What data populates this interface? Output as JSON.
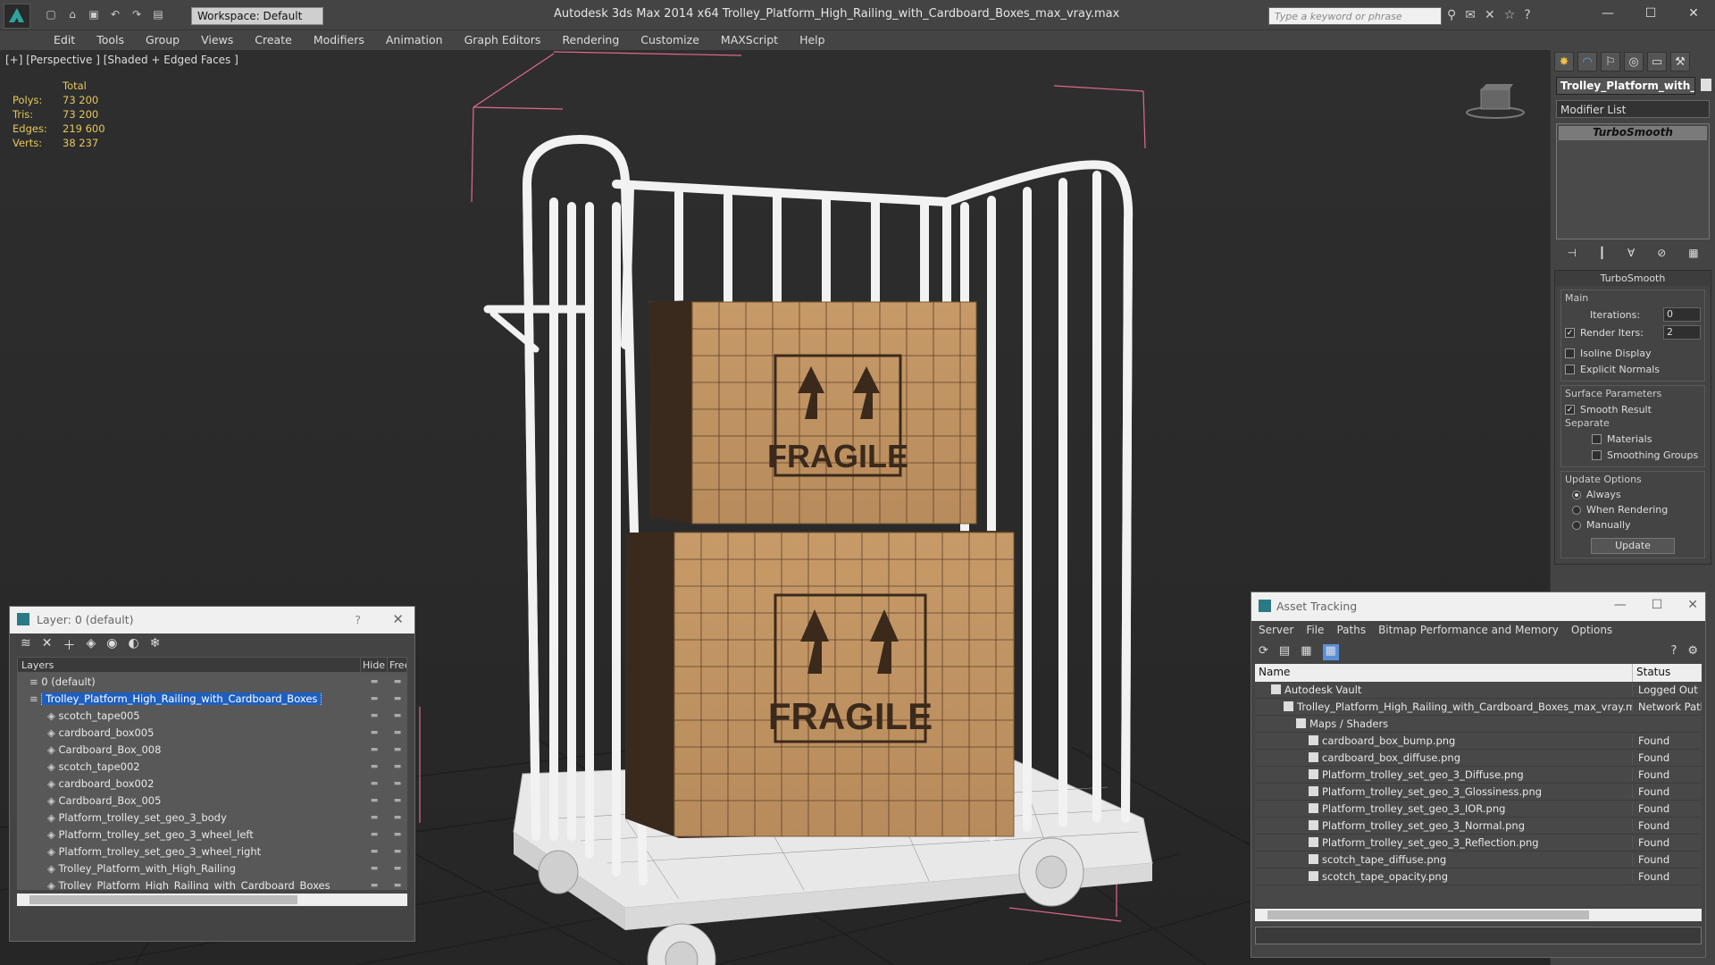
{
  "titlebar": {
    "workspace": "Workspace: Default",
    "title": "Autodesk 3ds Max  2014 x64     Trolley_Platform_High_Railing_with_Cardboard_Boxes_max_vray.max",
    "search_placeholder": "Type a keyword or phrase"
  },
  "menu": [
    "Edit",
    "Tools",
    "Group",
    "Views",
    "Create",
    "Modifiers",
    "Animation",
    "Graph Editors",
    "Rendering",
    "Customize",
    "MAXScript",
    "Help"
  ],
  "viewport": {
    "label": "[+] [Perspective ] [Shaded + Edged Faces ]",
    "stats": {
      "header": "Total",
      "rows": [
        {
          "k": "Polys:",
          "v": "73 200"
        },
        {
          "k": "Tris:",
          "v": "73 200"
        },
        {
          "k": "Edges:",
          "v": "219 600"
        },
        {
          "k": "Verts:",
          "v": "38 237"
        }
      ]
    },
    "box_label_top": "FRAGILE",
    "box_label_bottom": "FRAGILE"
  },
  "command_panel": {
    "object_name": "Trolley_Platform_with_H",
    "modifier_list": "Modifier List",
    "stack_item": "TurboSmooth",
    "rollout_title": "TurboSmooth",
    "main_label": "Main",
    "iterations_label": "Iterations:",
    "iterations_value": "0",
    "render_iters_label": "Render Iters:",
    "render_iters_value": "2",
    "isoline_label": "Isoline Display",
    "explicit_label": "Explicit Normals",
    "surface_label": "Surface Parameters",
    "smooth_result_label": "Smooth Result",
    "separate_label": "Separate",
    "materials_label": "Materials",
    "smoothing_label": "Smoothing Groups",
    "update_options_label": "Update Options",
    "radio_always": "Always",
    "radio_rendering": "When Rendering",
    "radio_manually": "Manually",
    "update_button": "Update"
  },
  "layer_window": {
    "title": "Layer: 0 (default)",
    "help": "?",
    "col_layers": "Layers",
    "col_hide": "Hide",
    "col_freeze": "Free",
    "rows": [
      {
        "label": "0 (default)",
        "indent": 0
      },
      {
        "label": "Trolley_Platform_High_Railing_with_Cardboard_Boxes",
        "indent": 0,
        "selected": true
      },
      {
        "label": "scotch_tape005",
        "indent": 1
      },
      {
        "label": "cardboard_box005",
        "indent": 1
      },
      {
        "label": "Cardboard_Box_008",
        "indent": 1
      },
      {
        "label": "scotch_tape002",
        "indent": 1
      },
      {
        "label": "cardboard_box002",
        "indent": 1
      },
      {
        "label": "Cardboard_Box_005",
        "indent": 1
      },
      {
        "label": "Platform_trolley_set_geo_3_body",
        "indent": 1
      },
      {
        "label": "Platform_trolley_set_geo_3_wheel_left",
        "indent": 1
      },
      {
        "label": "Platform_trolley_set_geo_3_wheel_right",
        "indent": 1
      },
      {
        "label": "Trolley_Platform_with_High_Railing",
        "indent": 1
      },
      {
        "label": "Trolley_Platform_High_Railing_with_Cardboard_Boxes",
        "indent": 1
      }
    ]
  },
  "asset_window": {
    "title": "Asset Tracking",
    "menu": [
      "Server",
      "File",
      "Paths",
      "Bitmap Performance and Memory",
      "Options"
    ],
    "col_name": "Name",
    "col_status": "Status",
    "rows": [
      {
        "name": "Autodesk Vault",
        "status": "Logged Out ...",
        "indent": 1
      },
      {
        "name": "Trolley_Platform_High_Railing_with_Cardboard_Boxes_max_vray.max",
        "status": "Network Path",
        "indent": 2
      },
      {
        "name": "Maps / Shaders",
        "status": "",
        "indent": 3
      },
      {
        "name": "cardboard_box_bump.png",
        "status": "Found",
        "indent": 4
      },
      {
        "name": "cardboard_box_diffuse.png",
        "status": "Found",
        "indent": 4
      },
      {
        "name": "Platform_trolley_set_geo_3_Diffuse.png",
        "status": "Found",
        "indent": 4
      },
      {
        "name": "Platform_trolley_set_geo_3_Glossiness.png",
        "status": "Found",
        "indent": 4
      },
      {
        "name": "Platform_trolley_set_geo_3_IOR.png",
        "status": "Found",
        "indent": 4
      },
      {
        "name": "Platform_trolley_set_geo_3_Normal.png",
        "status": "Found",
        "indent": 4
      },
      {
        "name": "Platform_trolley_set_geo_3_Reflection.png",
        "status": "Found",
        "indent": 4
      },
      {
        "name": "scotch_tape_diffuse.png",
        "status": "Found",
        "indent": 4
      },
      {
        "name": "scotch_tape_opacity.png",
        "status": "Found",
        "indent": 4
      }
    ]
  }
}
